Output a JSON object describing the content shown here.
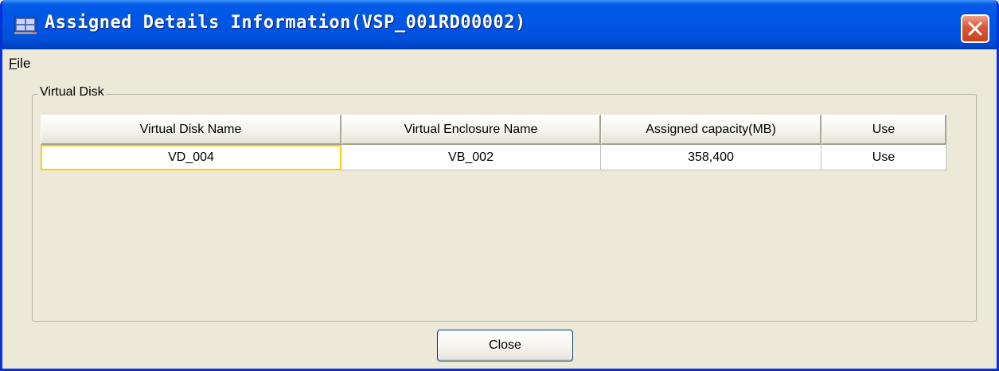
{
  "window": {
    "title": "Assigned Details Information(VSP_001RD00002)",
    "titlebar_color": "#0055e5",
    "close_button_color": "#e0593a"
  },
  "menu": {
    "file_label_first": "F",
    "file_label_rest": "ile"
  },
  "group": {
    "legend": "Virtual Disk"
  },
  "table": {
    "columns": [
      "Virtual Disk Name",
      "Virtual Enclosure Name",
      "Assigned capacity(MB)",
      "Use"
    ],
    "rows": [
      [
        "VD_004",
        "VB_002",
        "358,400",
        "Use"
      ]
    ]
  },
  "footer": {
    "close_label": "Close"
  },
  "icons": {
    "title_icon": "disk-array-icon",
    "close_icon": "close-x-icon"
  }
}
